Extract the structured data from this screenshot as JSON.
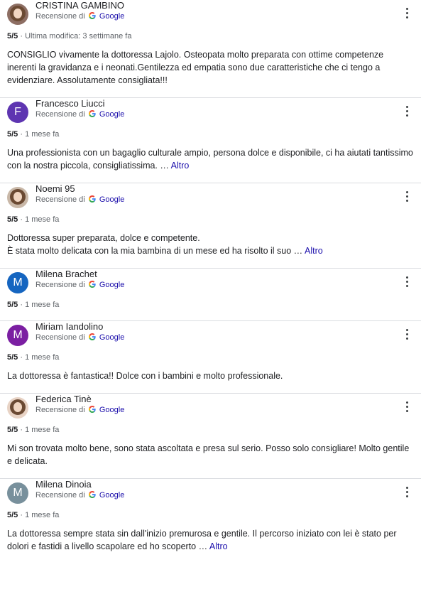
{
  "reviews": [
    {
      "name": "CRISTINA GAMBINO",
      "avatar_type": "photo",
      "avatar_letter": "",
      "avatar_color": "#8d6e63",
      "source_prefix": "Recensione di",
      "source_name": "Google",
      "rating": "5/5",
      "separator": " · ",
      "time": "Ultima modifica: 3 settimane fa",
      "text": "CONSIGLIO vivamente la dottoressa Lajolo. Osteopata molto preparata con ottime competenze inerenti la gravidanza e i neonati.Gentilezza ed empatia sono due caratteristiche che ci tengo a evidenziare. Assolutamente consigliata!!!",
      "more": ""
    },
    {
      "name": "Francesco Liucci",
      "avatar_type": "letter",
      "avatar_letter": "F",
      "avatar_color": "#5e35b1",
      "source_prefix": "Recensione di",
      "source_name": "Google",
      "rating": "5/5",
      "separator": " · ",
      "time": "1 mese fa",
      "text": "Una professionista con un bagaglio culturale ampio, persona dolce e disponibile, ci ha aiutati tantissimo con la nostra piccola, consigliatissima. … ",
      "more": "Altro"
    },
    {
      "name": "Noemi 95",
      "avatar_type": "photo",
      "avatar_letter": "",
      "avatar_color": "#c9b8a8",
      "source_prefix": "Recensione di",
      "source_name": "Google",
      "rating": "5/5",
      "separator": " · ",
      "time": "1 mese fa",
      "text": "Dottoressa super preparata, dolce e competente.\nÈ stata molto delicata con la mia bambina di un mese ed ha risolto il suo … ",
      "more": "Altro"
    },
    {
      "name": "Milena Brachet",
      "avatar_type": "letter",
      "avatar_letter": "M",
      "avatar_color": "#1565c0",
      "source_prefix": "Recensione di",
      "source_name": "Google",
      "rating": "5/5",
      "separator": " · ",
      "time": "1 mese fa",
      "text": "",
      "more": ""
    },
    {
      "name": "Miriam Iandolino",
      "avatar_type": "letter",
      "avatar_letter": "M",
      "avatar_color": "#7b1fa2",
      "source_prefix": "Recensione di",
      "source_name": "Google",
      "rating": "5/5",
      "separator": " · ",
      "time": "1 mese fa",
      "text": "La dottoressa è fantastica!! Dolce con i bambini e molto professionale.",
      "more": ""
    },
    {
      "name": "Federica Tinè",
      "avatar_type": "photo",
      "avatar_letter": "",
      "avatar_color": "#e8d3c5",
      "source_prefix": "Recensione di",
      "source_name": "Google",
      "rating": "5/5",
      "separator": " · ",
      "time": "1 mese fa",
      "text": "Mi son trovata molto bene, sono stata ascoltata e presa sul serio. Posso solo consigliare! Molto gentile e delicata.",
      "more": ""
    },
    {
      "name": "Milena Dinoia",
      "avatar_type": "letter",
      "avatar_letter": "M",
      "avatar_color": "#78909c",
      "source_prefix": "Recensione di",
      "source_name": "Google",
      "rating": "5/5",
      "separator": " · ",
      "time": "1 mese fa",
      "text": "La dottoressa sempre stata sin dall'inizio premurosa e gentile. Il percorso iniziato con lei è stato per dolori e fastidi a livello scapolare ed ho scoperto … ",
      "more": "Altro"
    }
  ]
}
